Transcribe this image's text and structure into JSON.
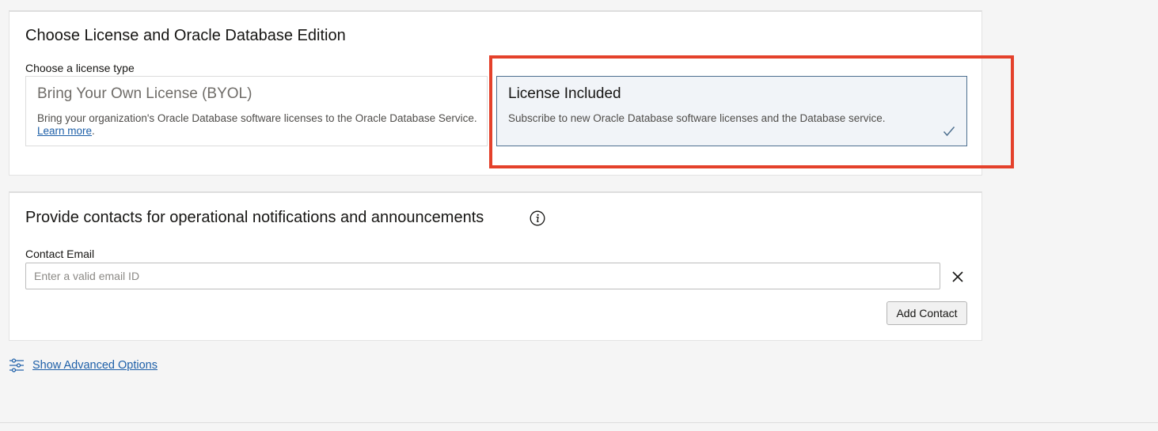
{
  "license_section": {
    "title": "Choose License and Oracle Database Edition",
    "license_type_label": "Choose a license type",
    "options": [
      {
        "title": "Bring Your Own License (BYOL)",
        "description": "Bring your organization's Oracle Database software licenses to the Oracle Database Service.",
        "link_text": "Learn more",
        "trailing_text": ".",
        "selected": false
      },
      {
        "title": "License Included",
        "description": "Subscribe to new Oracle Database software licenses and the Database service.",
        "selected": true
      }
    ]
  },
  "contacts_section": {
    "title": "Provide contacts for operational notifications and announcements",
    "contact_email_label": "Contact Email",
    "email_value": "",
    "email_placeholder": "Enter a valid email ID",
    "add_contact_label": "Add Contact"
  },
  "advanced_options": {
    "link_text": "Show Advanced Options"
  },
  "icons": {
    "info": "info-icon",
    "clear": "close-icon",
    "check": "checkmark-icon",
    "sliders": "sliders-icon"
  },
  "colors": {
    "accent_link": "#1d5fa8",
    "selected_card_bg": "#f1f4f8",
    "selected_card_border": "#4d6f8f",
    "highlight_annotation": "#e4412b",
    "check": "#4d6f8f"
  }
}
